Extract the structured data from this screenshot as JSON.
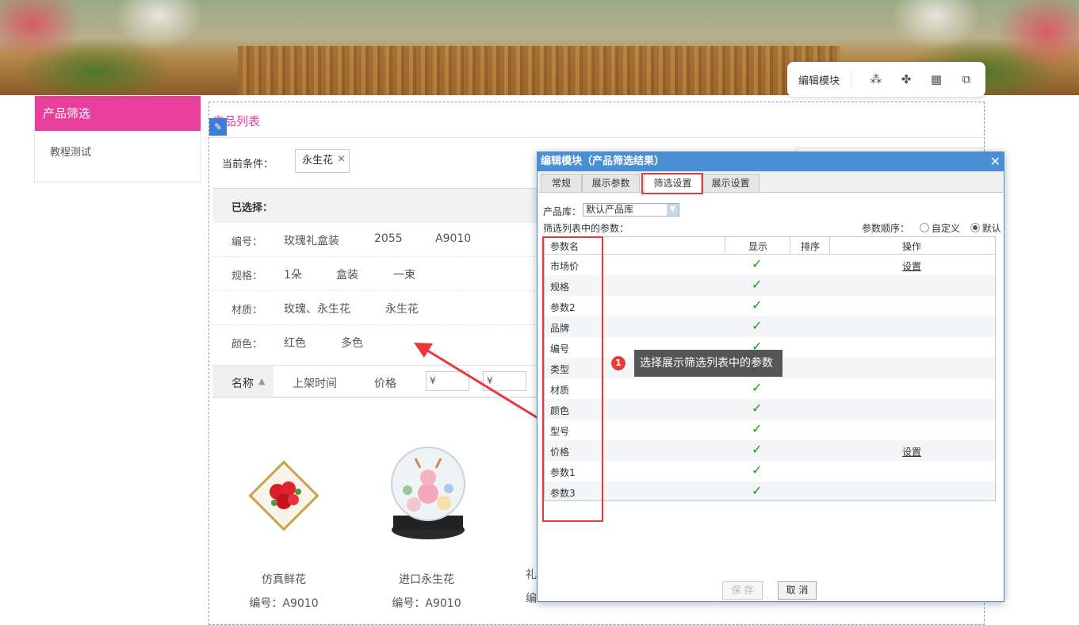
{
  "toolbar": {
    "edit_module_label": "编辑模块",
    "icons": [
      "magic-wand-icon",
      "pinwheel-icon",
      "grid-icon",
      "screen-select-icon"
    ]
  },
  "sidebar": {
    "title": "产品筛选",
    "items": [
      "教程测试"
    ]
  },
  "product_list": {
    "title": "产品列表",
    "current_conditions_label": "当前条件：",
    "condition_tag": "永生花",
    "selected_label": "已选择：",
    "filters": [
      {
        "label": "编号：",
        "values": [
          "玫瑰礼盒装",
          "2055",
          "A9010"
        ]
      },
      {
        "label": "规格：",
        "values": [
          "1朵",
          "盒装",
          "一束"
        ]
      },
      {
        "label": "材质：",
        "values": [
          "玫瑰、永生花",
          "永生花"
        ]
      },
      {
        "label": "颜色：",
        "values": [
          "红色",
          "多色"
        ]
      }
    ],
    "sort": {
      "name": "名称",
      "shelf_time": "上架时间",
      "price": "价格",
      "price_min_placeholder": "¥",
      "price_max_placeholder": "¥"
    },
    "products": [
      {
        "name": "仿真鲜花",
        "code": "编号：A9010"
      },
      {
        "name": "进口永生花",
        "code": "编号：A9010"
      },
      {
        "name": "礼",
        "code": "编"
      }
    ]
  },
  "callout": {
    "number": "1",
    "text": "选择展示筛选列表中的参数"
  },
  "dialog": {
    "title": "编辑模块（产品筛选结果）",
    "close": "✕",
    "tabs": [
      "常规",
      "展示参数",
      "筛选设置",
      "展示设置"
    ],
    "active_tab": "筛选设置",
    "library_label": "产品库：",
    "library_value": "默认产品库",
    "params_label": "筛选列表中的参数：",
    "order_label": "参数顺序：",
    "order_custom": "自定义",
    "order_default": "默认",
    "columns": {
      "name": "参数名",
      "show": "显示",
      "sort": "排序",
      "action": "操作"
    },
    "rows": [
      {
        "name": "市场价",
        "shown": true,
        "action": "设置"
      },
      {
        "name": "规格",
        "shown": true,
        "action": ""
      },
      {
        "name": "参数2",
        "shown": true,
        "action": ""
      },
      {
        "name": "品牌",
        "shown": true,
        "action": ""
      },
      {
        "name": "编号",
        "shown": true,
        "action": ""
      },
      {
        "name": "类型",
        "shown": true,
        "action": ""
      },
      {
        "name": "材质",
        "shown": true,
        "action": ""
      },
      {
        "name": "颜色",
        "shown": true,
        "action": ""
      },
      {
        "name": "型号",
        "shown": true,
        "action": ""
      },
      {
        "name": "价格",
        "shown": true,
        "action": "设置"
      },
      {
        "name": "参数1",
        "shown": true,
        "action": ""
      },
      {
        "name": "参数3",
        "shown": true,
        "action": ""
      }
    ],
    "check_glyph": "✓",
    "save_label": "保 存",
    "cancel_label": "取 消"
  },
  "colors": {
    "brand_pink": "#e83e9c",
    "dialog_blue": "#4a8fd4",
    "highlight_red": "#e8383d",
    "check_green": "#1a9b1a"
  }
}
